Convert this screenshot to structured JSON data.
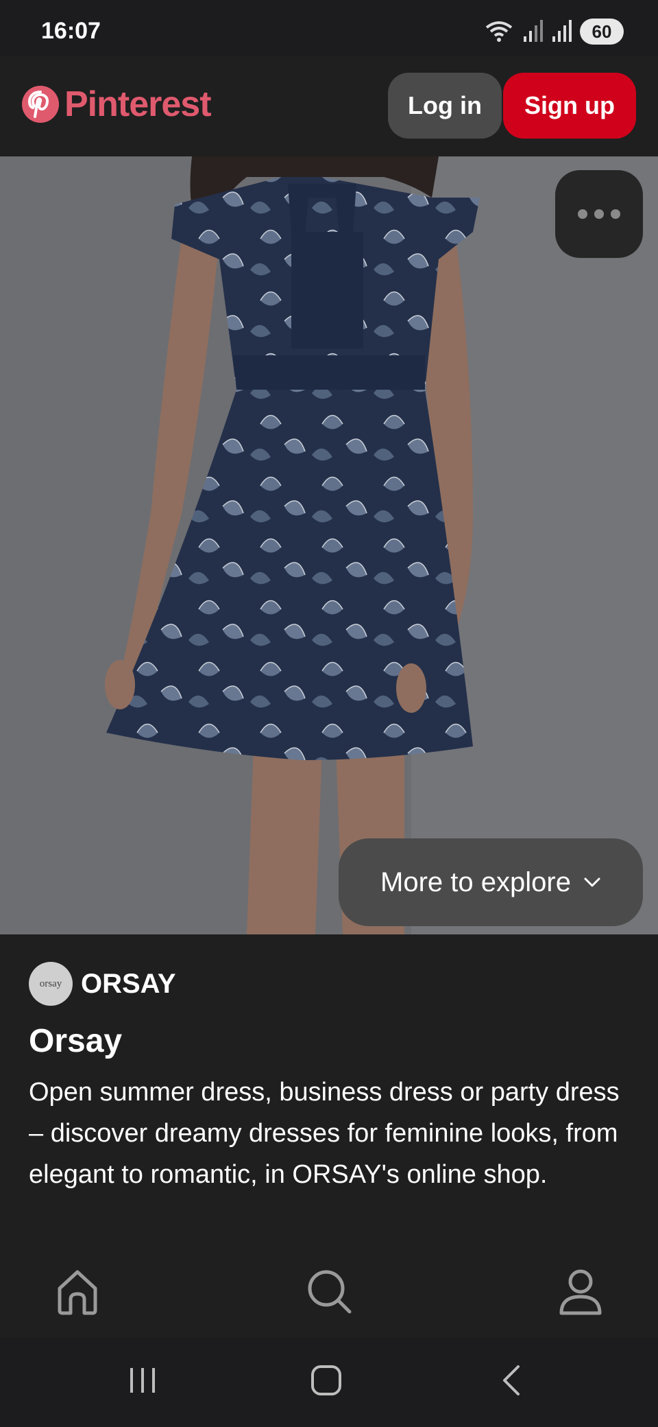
{
  "status_bar": {
    "time": "16:07",
    "battery": "60",
    "icons": [
      "wifi-icon",
      "signal-icon",
      "signal-icon"
    ]
  },
  "header": {
    "logo_text": "Pinterest",
    "login_label": "Log in",
    "signup_label": "Sign up",
    "colors": {
      "brand": "#e05a6e",
      "signup": "#d0021b"
    }
  },
  "pin": {
    "more_icon": "more-options-icon",
    "explore_label": "More to explore",
    "creator": {
      "avatar_text": "orsay",
      "name": "ORSAY"
    },
    "title": "Orsay",
    "description": "Open summer dress, business dress or party dress – discover dreamy dresses for feminine looks, from elegant to romantic, in ORSAY's online shop."
  },
  "bottom_nav": {
    "items": [
      "home-icon",
      "search-icon",
      "profile-icon"
    ]
  },
  "system_nav": {
    "items": [
      "recent-apps-icon",
      "home-icon",
      "back-icon"
    ]
  }
}
